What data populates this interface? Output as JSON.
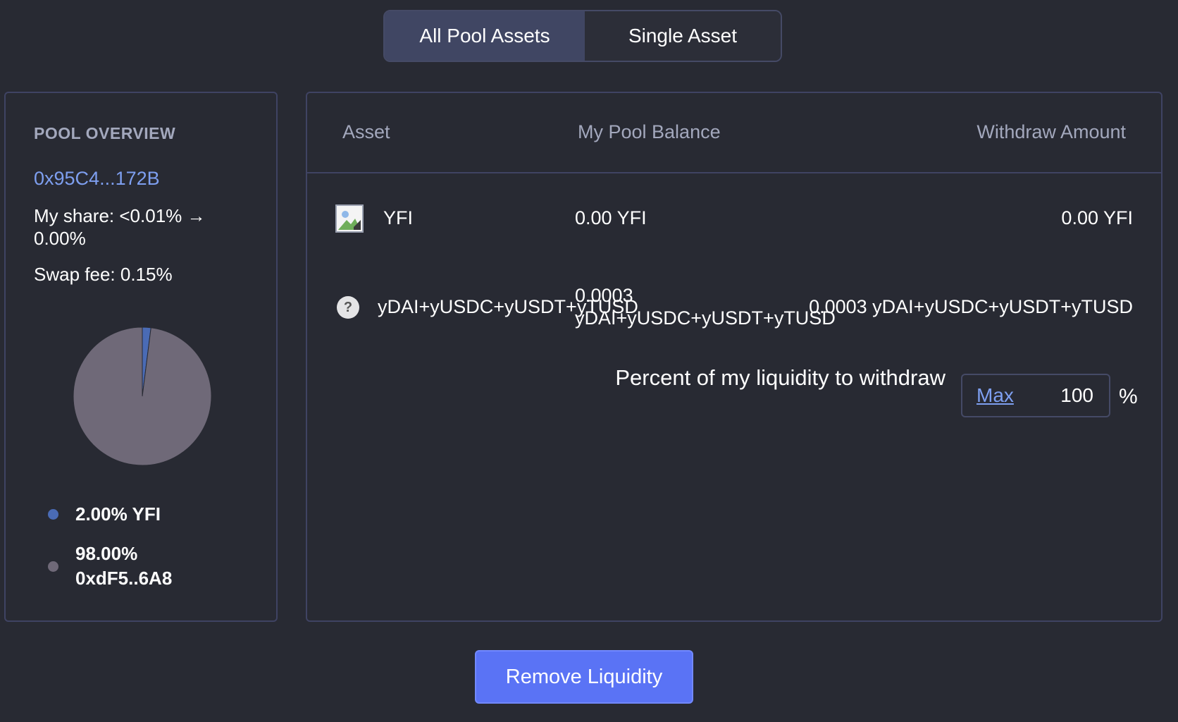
{
  "tabs": {
    "all_pool_assets": "All Pool Assets",
    "single_asset": "Single Asset",
    "active": "All Pool Assets"
  },
  "overview": {
    "title": "POOL OVERVIEW",
    "address": "0x95C4...172B",
    "my_share": "My share: <0.01% → 0.00%",
    "swap_fee": "Swap fee: 0.15%",
    "legend": [
      {
        "label": "2.00% YFI",
        "percent": 2.0,
        "color": "#4a6bb5"
      },
      {
        "label": "98.00% 0xdF5..6A8",
        "percent": 98.0,
        "color": "#6f6978"
      }
    ]
  },
  "table": {
    "headers": {
      "asset": "Asset",
      "balance": "My Pool Balance",
      "withdraw": "Withdraw Amount"
    },
    "rows": [
      {
        "icon": "token-image-icon",
        "asset": "YFI",
        "balance": "0.00 YFI",
        "withdraw": "0.00 YFI"
      },
      {
        "icon": "question-icon",
        "asset": "yDAI+yUSDC+yUSDT+yTUSD",
        "balance_line1": "0.0003",
        "balance_line2": "yDAI+yUSDC+yUSDT+yTUSD",
        "withdraw": "0.0003 yDAI+yUSDC+yUSDT+yTUSD"
      }
    ]
  },
  "withdraw": {
    "label": "Percent of my liquidity to withdraw",
    "max_label": "Max",
    "value": "100",
    "unit": "%"
  },
  "actions": {
    "remove_label": "Remove Liquidity"
  },
  "colors": {
    "background": "#282a33",
    "accent": "#5a73f5",
    "link": "#7e9ff0"
  }
}
